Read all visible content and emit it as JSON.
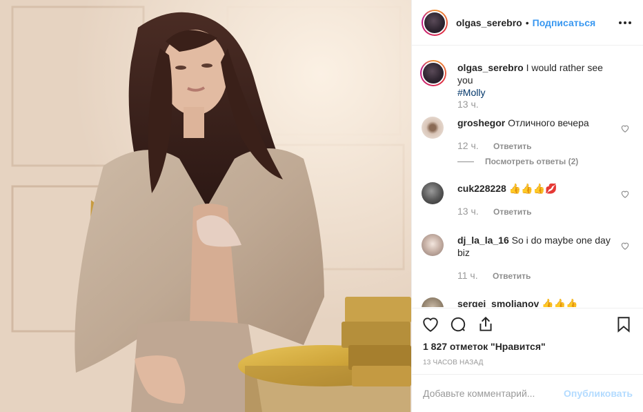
{
  "post": {
    "author": "olgas_serebro",
    "separator": "•",
    "follow_label": "Подписаться",
    "more_icon": "more-horizontal-icon"
  },
  "caption": {
    "user": "olgas_serebro",
    "text": "I would rather see you",
    "hashtag": "#Molly",
    "time": "13 ч."
  },
  "comments": [
    {
      "user": "groshegor",
      "text": "Отличного вечера",
      "time": "12 ч.",
      "reply": "Ответить",
      "view_replies": "Посмотреть ответы (2)"
    },
    {
      "user": "cuk228228",
      "text": "👍👍👍💋",
      "time": "13 ч.",
      "reply": "Ответить"
    },
    {
      "user": "dj_la_la_16",
      "text": "So i do maybe one day biz",
      "time": "11 ч.",
      "reply": "Ответить"
    },
    {
      "user": "sergei_smolianov",
      "text": "👍👍👍"
    }
  ],
  "stats": {
    "likes": "1 827 отметок \"Нравится\"",
    "posted_ago": "13 ЧАСОВ НАЗАД"
  },
  "add_comment": {
    "placeholder": "Добавьте комментарий...",
    "post_label": "Опубликовать"
  },
  "colors": {
    "link": "#3897f0",
    "hashtag": "#003569",
    "muted": "#8e8e8e",
    "post_disabled": "#b3dbff"
  },
  "icons": [
    "heart-icon",
    "comment-icon",
    "share-icon",
    "bookmark-icon"
  ]
}
